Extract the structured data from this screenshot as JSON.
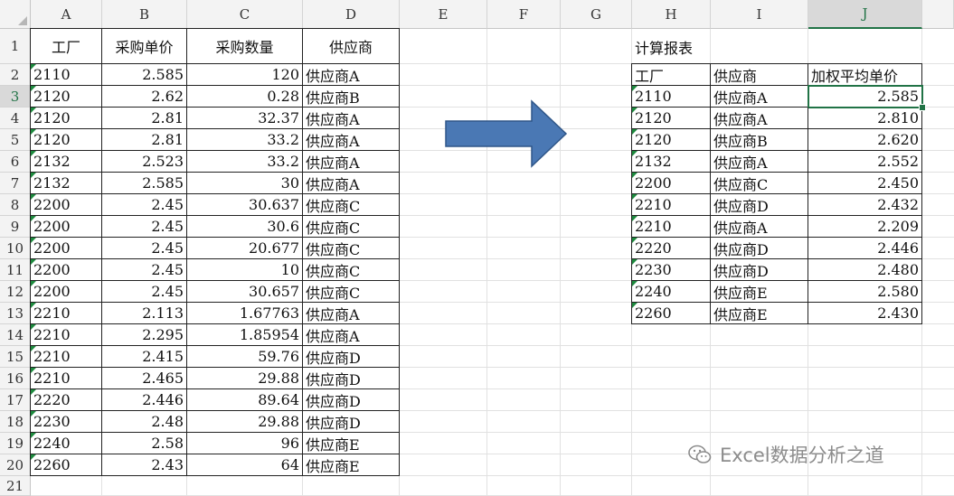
{
  "columns": [
    "A",
    "B",
    "C",
    "D",
    "E",
    "F",
    "G",
    "H",
    "I",
    "J"
  ],
  "rows": [
    "1",
    "2",
    "3",
    "4",
    "5",
    "6",
    "7",
    "8",
    "9",
    "10",
    "11",
    "12",
    "13",
    "14",
    "15",
    "16",
    "17",
    "18",
    "19",
    "20",
    "21"
  ],
  "source_table": {
    "headers": [
      "工厂",
      "采购单价",
      "采购数量",
      "供应商"
    ],
    "rows": [
      [
        "2110",
        "2.585",
        "120",
        "供应商A"
      ],
      [
        "2120",
        "2.62",
        "0.28",
        "供应商B"
      ],
      [
        "2120",
        "2.81",
        "32.37",
        "供应商A"
      ],
      [
        "2120",
        "2.81",
        "33.2",
        "供应商A"
      ],
      [
        "2132",
        "2.523",
        "33.2",
        "供应商A"
      ],
      [
        "2132",
        "2.585",
        "30",
        "供应商A"
      ],
      [
        "2200",
        "2.45",
        "30.637",
        "供应商C"
      ],
      [
        "2200",
        "2.45",
        "30.6",
        "供应商C"
      ],
      [
        "2200",
        "2.45",
        "20.677",
        "供应商C"
      ],
      [
        "2200",
        "2.45",
        "10",
        "供应商C"
      ],
      [
        "2200",
        "2.45",
        "30.657",
        "供应商C"
      ],
      [
        "2210",
        "2.113",
        "1.67763",
        "供应商A"
      ],
      [
        "2210",
        "2.295",
        "1.85954",
        "供应商A"
      ],
      [
        "2210",
        "2.415",
        "59.76",
        "供应商D"
      ],
      [
        "2210",
        "2.465",
        "29.88",
        "供应商D"
      ],
      [
        "2220",
        "2.446",
        "89.64",
        "供应商D"
      ],
      [
        "2230",
        "2.48",
        "29.88",
        "供应商D"
      ],
      [
        "2240",
        "2.58",
        "96",
        "供应商E"
      ],
      [
        "2260",
        "2.43",
        "64",
        "供应商E"
      ]
    ]
  },
  "report": {
    "title": "计算报表",
    "headers": [
      "工厂",
      "供应商",
      "加权平均单价"
    ],
    "rows": [
      [
        "2110",
        "供应商A",
        "2.585"
      ],
      [
        "2120",
        "供应商A",
        "2.810"
      ],
      [
        "2120",
        "供应商B",
        "2.620"
      ],
      [
        "2132",
        "供应商A",
        "2.552"
      ],
      [
        "2200",
        "供应商C",
        "2.450"
      ],
      [
        "2210",
        "供应商D",
        "2.432"
      ],
      [
        "2210",
        "供应商A",
        "2.209"
      ],
      [
        "2220",
        "供应商D",
        "2.446"
      ],
      [
        "2230",
        "供应商D",
        "2.480"
      ],
      [
        "2240",
        "供应商E",
        "2.580"
      ],
      [
        "2260",
        "供应商E",
        "2.430"
      ]
    ]
  },
  "watermark": "Excel数据分析之道",
  "arrow_color": "#4a78b4",
  "accent": "#217346"
}
